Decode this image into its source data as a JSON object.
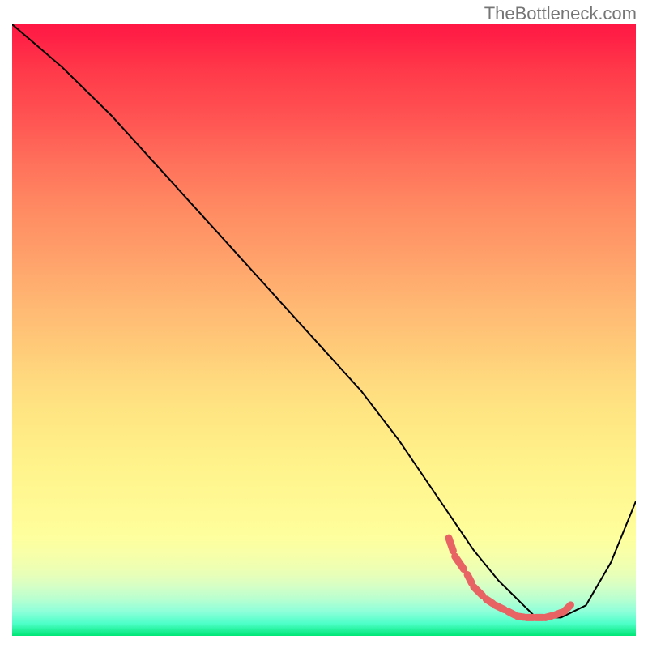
{
  "watermark": "TheBottleneck.com",
  "chart_data": {
    "type": "line",
    "title": "",
    "xlabel": "",
    "ylabel": "",
    "xlim": [
      0,
      100
    ],
    "ylim": [
      0,
      100
    ],
    "series": [
      {
        "name": "bottleneck-curve",
        "color": "#000000",
        "x": [
          0,
          8,
          16,
          24,
          32,
          40,
          48,
          56,
          62,
          66,
          70,
          74,
          78,
          82,
          84,
          88,
          92,
          96,
          100
        ],
        "y": [
          100,
          93,
          85,
          76,
          67,
          58,
          49,
          40,
          32,
          26,
          20,
          14,
          9,
          5,
          3,
          3,
          5,
          12,
          22
        ]
      },
      {
        "name": "optimal-range-dashes",
        "color": "#e86464",
        "x": [
          70,
          71,
          73,
          74,
          76,
          77.5,
          79.5,
          81,
          82.5,
          84,
          85.5,
          87,
          88.5,
          90
        ],
        "y": [
          16,
          13,
          10,
          8,
          6,
          5,
          4,
          3.2,
          3,
          3,
          3,
          3.4,
          4,
          5.5
        ]
      }
    ],
    "gradient_stops": [
      {
        "pos": 0,
        "color": "#ff1744"
      },
      {
        "pos": 50,
        "color": "#ffd97e"
      },
      {
        "pos": 80,
        "color": "#fffb96"
      },
      {
        "pos": 100,
        "color": "#00e676"
      }
    ]
  }
}
